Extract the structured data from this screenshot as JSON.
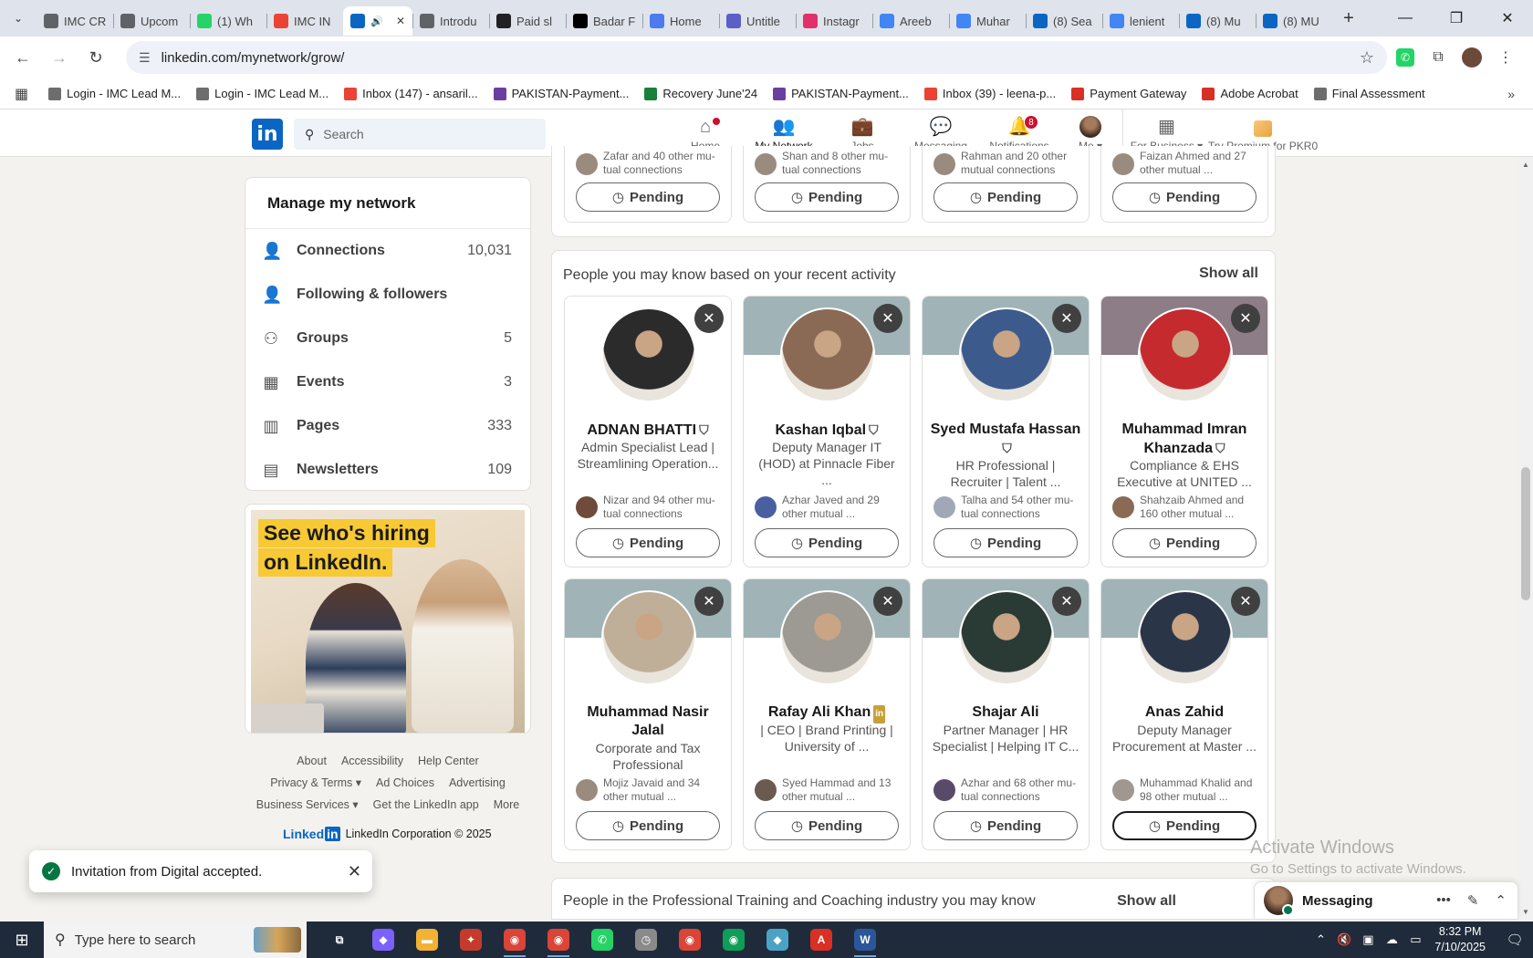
{
  "browser": {
    "tabs": [
      {
        "label": "IMC CR",
        "color": "#5f6368"
      },
      {
        "label": "Upcom",
        "color": "#5f6368"
      },
      {
        "label": "(1) Wh",
        "color": "#25d366"
      },
      {
        "label": "IMC IN",
        "color": "#ea4335"
      },
      {
        "label": "",
        "color": "#0a66c2",
        "active": true
      },
      {
        "label": "Introdu",
        "color": "#5f6368"
      },
      {
        "label": "Paid sl",
        "color": "#202124"
      },
      {
        "label": "Badar F",
        "color": "#000000"
      },
      {
        "label": "Home",
        "color": "#4b7bec"
      },
      {
        "label": "Untitle",
        "color": "#5b5fc7"
      },
      {
        "label": "Instagr",
        "color": "#e1306c"
      },
      {
        "label": "Areeb",
        "color": "#4285f4"
      },
      {
        "label": "Muhar",
        "color": "#4285f4"
      },
      {
        "label": "(8) Sea",
        "color": "#0a66c2"
      },
      {
        "label": "lenient",
        "color": "#4285f4"
      },
      {
        "label": "(8) Mu",
        "color": "#0a66c2"
      },
      {
        "label": "(8) MU",
        "color": "#0a66c2"
      }
    ],
    "url": "linkedin.com/mynetwork/grow/",
    "bookmarks": [
      {
        "label": "Login - IMC Lead M...",
        "color": "#6d6d6d"
      },
      {
        "label": "Login - IMC Lead M...",
        "color": "#6d6d6d"
      },
      {
        "label": "Inbox (147) - ansaril...",
        "color": "#ea4335"
      },
      {
        "label": "PAKISTAN-Payment...",
        "color": "#6a3fa0"
      },
      {
        "label": "Recovery June'24",
        "color": "#188038"
      },
      {
        "label": "PAKISTAN-Payment...",
        "color": "#6a3fa0"
      },
      {
        "label": "Inbox (39) - leena-p...",
        "color": "#ea4335"
      },
      {
        "label": "Payment Gateway",
        "color": "#d93025"
      },
      {
        "label": "Adobe Acrobat",
        "color": "#d93025"
      },
      {
        "label": "Final Assessment",
        "color": "#6d6d6d"
      }
    ]
  },
  "header": {
    "logo": "in",
    "search_placeholder": "Search",
    "nav": [
      {
        "label": "Home",
        "icon": "home-icon",
        "badge": "",
        "dot": true
      },
      {
        "label": "My Network",
        "icon": "people-icon",
        "active": true
      },
      {
        "label": "Jobs",
        "icon": "briefcase-icon"
      },
      {
        "label": "Messaging",
        "icon": "chat-icon"
      },
      {
        "label": "Notifications",
        "icon": "bell-icon",
        "badge": "8"
      },
      {
        "label": "Me",
        "icon": "avatar"
      },
      {
        "label": "For Business",
        "icon": "grid-icon"
      },
      {
        "label": "Try Premium for PKR0",
        "icon": "premium-icon"
      }
    ]
  },
  "sidebar": {
    "title": "Manage my network",
    "items": [
      {
        "label": "Connections",
        "count": "10,031",
        "icon": "connections-icon"
      },
      {
        "label": "Following & followers",
        "count": "",
        "icon": "person-icon"
      },
      {
        "label": "Groups",
        "count": "5",
        "icon": "groups-icon"
      },
      {
        "label": "Events",
        "count": "3",
        "icon": "calendar-icon"
      },
      {
        "label": "Pages",
        "count": "333",
        "icon": "building-icon"
      },
      {
        "label": "Newsletters",
        "count": "109",
        "icon": "newsletter-icon"
      }
    ],
    "ad": {
      "line1": "See who's hiring",
      "line2": "on LinkedIn."
    },
    "footer": {
      "row1": [
        "About",
        "Accessibility",
        "Help Center"
      ],
      "row2": [
        "Privacy & Terms ▾",
        "Ad Choices",
        "Advertising"
      ],
      "row3": [
        "Business Services ▾",
        "Get the LinkedIn app",
        "More"
      ],
      "brand": "Linked",
      "copyright": "LinkedIn Corporation © 2025"
    }
  },
  "top_row": [
    {
      "mutual": "Zafar and 40 other mu-tual connections",
      "button": "Pending"
    },
    {
      "mutual": "Shan and 8 other mu-tual connections",
      "button": "Pending"
    },
    {
      "mutual": "Rahman and 20 other mutual connections",
      "button": "Pending"
    },
    {
      "mutual": "Faizan Ahmed and 27 other mutual ...",
      "button": "Pending"
    }
  ],
  "section": {
    "title": "People you may know based on your recent activity",
    "show_all": "Show all",
    "people": [
      {
        "name": "ADNAN BHATTI",
        "verified": true,
        "headline": "Admin Specialist Lead | Streamlining Operation...",
        "mutual": "Nizar and 94 other mu-tual connections",
        "button": "Pending",
        "banner": "#ffffff",
        "avatar": "#2b2b2b",
        "mav": "#6e4b3a"
      },
      {
        "name": "Kashan Iqbal",
        "verified": true,
        "headline": "Deputy Manager IT (HOD) at Pinnacle Fiber ...",
        "mutual": "Azhar Javed and 29 other mutual ...",
        "button": "Pending",
        "banner": "#a0b4b7",
        "avatar": "#8a6a55",
        "mav": "#4a5fa0"
      },
      {
        "name": "Syed Mustafa Hassan",
        "verified": true,
        "headline": "HR Professional | Recruiter | Talent ...",
        "mutual": "Talha and 54 other mu-tual connections",
        "button": "Pending",
        "banner": "#a0b4b7",
        "avatar": "#3c5a8c",
        "mav": "#a0a8b8"
      },
      {
        "name": "Muhammad Imran Khanzada",
        "verified": true,
        "headline": "Compliance & EHS Executive at UNITED ...",
        "mutual": "Shahzaib Ahmed and 160 other mutual ...",
        "button": "Pending",
        "banner": "#8c7d86",
        "avatar": "#c42a2e",
        "mav": "#8a6a55"
      },
      {
        "name": "Muhammad Nasir Jalal",
        "verified": false,
        "headline": "Corporate and Tax Professional",
        "mutual": "Mojiz Javaid and 34 other mutual ...",
        "button": "Pending",
        "banner": "#a0b4b7",
        "avatar": "#bfae98",
        "mav": "#9a8b7f"
      },
      {
        "name": "Rafay Ali Khan",
        "verified": false,
        "premium": true,
        "headline": "| CEO | Brand Printing | University of ...",
        "mutual": "Syed Hammad and 13 other mutual ...",
        "button": "Pending",
        "banner": "#a0b4b7",
        "avatar": "#9c9a92",
        "mav": "#6a5a50"
      },
      {
        "name": "Shajar Ali",
        "verified": false,
        "headline": "Partner Manager | HR Specialist | Helping IT C...",
        "mutual": "Azhar and 68 other mu-tual connections",
        "button": "Pending",
        "banner": "#a0b4b7",
        "avatar": "#2a3a34",
        "mav": "#5a4a6a"
      },
      {
        "name": "Anas Zahid",
        "verified": false,
        "headline": "Deputy Manager Procurement at Master ...",
        "mutual": "Muhammad Khalid and 98 other mutual ...",
        "button": "Pending",
        "focused": true,
        "banner": "#a0b4b7",
        "avatar": "#2a3548",
        "mav": "#a09890"
      }
    ]
  },
  "next_section": {
    "title": "People in the Professional Training and Coaching industry you may know",
    "show_all": "Show all"
  },
  "toast": {
    "text": "Invitation from Digital accepted."
  },
  "watermark": {
    "line1": "Activate Windows",
    "line2": "Go to Settings to activate Windows."
  },
  "messaging": {
    "title": "Messaging"
  },
  "taskbar": {
    "search_placeholder": "Type here to search",
    "time": "8:32 PM",
    "date": "7/10/2025",
    "apps": [
      {
        "name": "task-view",
        "color": "#1f2b3b",
        "glyph": "⧉"
      },
      {
        "name": "copilot",
        "color": "#7b61ff",
        "glyph": "◆"
      },
      {
        "name": "file-explorer",
        "color": "#f2b233",
        "glyph": "▬"
      },
      {
        "name": "app-red",
        "color": "#c43b2c",
        "glyph": "✦"
      },
      {
        "name": "chrome-1",
        "color": "#db4437",
        "glyph": "◉",
        "running": true
      },
      {
        "name": "chrome-2",
        "color": "#db4437",
        "glyph": "◉",
        "running": true
      },
      {
        "name": "whatsapp",
        "color": "#25d366",
        "glyph": "✆"
      },
      {
        "name": "clock-app",
        "color": "#8a8a8a",
        "glyph": "◷"
      },
      {
        "name": "chrome-3",
        "color": "#db4437",
        "glyph": "◉"
      },
      {
        "name": "chrome-4",
        "color": "#0f9d58",
        "glyph": "◉"
      },
      {
        "name": "app-teal",
        "color": "#4aa3c4",
        "glyph": "◆"
      },
      {
        "name": "acrobat",
        "color": "#d93025",
        "glyph": "A"
      },
      {
        "name": "word",
        "color": "#2b579a",
        "glyph": "W",
        "running": true
      }
    ]
  }
}
